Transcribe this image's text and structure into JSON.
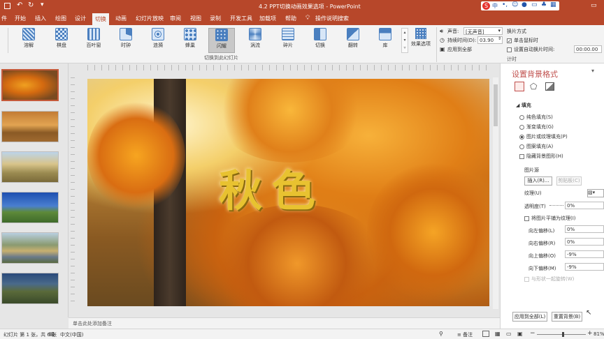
{
  "titlebar": {
    "doc_title": "4.2 PPT切换动画效果选项 - PowerPoint",
    "ime_label": "中",
    "window_btns": [
      "─",
      "□",
      "✕"
    ]
  },
  "tabs": [
    {
      "label": "件"
    },
    {
      "label": "开始"
    },
    {
      "label": "插入"
    },
    {
      "label": "绘图"
    },
    {
      "label": "设计"
    },
    {
      "label": "切换",
      "active": true
    },
    {
      "label": "动画"
    },
    {
      "label": "幻灯片放映"
    },
    {
      "label": "审阅"
    },
    {
      "label": "视图"
    },
    {
      "label": "录制"
    },
    {
      "label": "开发工具"
    },
    {
      "label": "加载项"
    },
    {
      "label": "帮助"
    },
    {
      "label": "操作说明搜索"
    }
  ],
  "ribbon": {
    "effects": [
      {
        "label": "溶解",
        "icon": "dissolve-icon"
      },
      {
        "label": "棋盘",
        "icon": "checkerboard-icon"
      },
      {
        "label": "百叶窗",
        "icon": "blinds-icon"
      },
      {
        "label": "时钟",
        "icon": "clock-icon"
      },
      {
        "label": "涟漪",
        "icon": "ripple-icon"
      },
      {
        "label": "蜂巢",
        "icon": "honeycomb-icon"
      },
      {
        "label": "闪耀",
        "icon": "glitter-icon",
        "selected": true
      },
      {
        "label": "涡流",
        "icon": "vortex-icon"
      },
      {
        "label": "碎片",
        "icon": "shred-icon"
      },
      {
        "label": "切换",
        "icon": "switch-icon"
      },
      {
        "label": "翻转",
        "icon": "flip-icon"
      },
      {
        "label": "库",
        "icon": "gallery-icon"
      }
    ],
    "effect_options_label": "效果选项",
    "group_label": "切换到此幻灯片",
    "sound_label": "声音:",
    "sound_value": "[无声音]",
    "duration_label": "持续时间(D):",
    "duration_value": "03.90",
    "apply_all_label": "应用到全部",
    "advance_label": "换片方式",
    "on_click_label": "单击鼠标时",
    "auto_label": "设置自动换片时间:",
    "auto_value": "00:00.00",
    "timing_label": "计时"
  },
  "slide": {
    "title_text": "秋色"
  },
  "thumbnails": [
    {
      "num": "1",
      "tone": "autumn"
    },
    {
      "num": "2",
      "tone": "desert"
    },
    {
      "num": "3",
      "tone": "hills"
    },
    {
      "num": "4",
      "tone": "blue-sky"
    },
    {
      "num": "5",
      "tone": "river"
    },
    {
      "num": "6",
      "tone": "forest"
    }
  ],
  "format_pane": {
    "title": "设置背景格式",
    "section_fill": "填充",
    "fill_options": [
      {
        "label": "纯色填充(S)",
        "on": false
      },
      {
        "label": "渐变填充(G)",
        "on": false
      },
      {
        "label": "图片或纹理填充(P)",
        "on": true
      },
      {
        "label": "图案填充(A)",
        "on": false
      }
    ],
    "hide_bg_label": "隐藏背景图形(H)",
    "picture_source_label": "图片源",
    "insert_btn": "插入(R)...",
    "clipboard_btn": "剪贴板(C)",
    "texture_label": "纹理(U)",
    "transparency_label": "透明度(T)",
    "transparency_value": "0%",
    "tile_label": "将图片平铺为纹理(I)",
    "offsets": [
      {
        "label": "向左偏移(L)",
        "value": "0%"
      },
      {
        "label": "向右偏移(R)",
        "value": "0%"
      },
      {
        "label": "向上偏移(O)",
        "value": "-9%"
      },
      {
        "label": "向下偏移(M)",
        "value": "-9%"
      }
    ],
    "rotate_label": "与形状一起旋转(W)",
    "apply_all_btn": "应用到全部(L)",
    "reset_btn": "重置背景(B)"
  },
  "notes_placeholder": "单击此处添加备注",
  "status": {
    "slide_info": "幻灯片 第 1 张，共 6 张",
    "language": "中文(中国)",
    "notes_btn": "备注",
    "zoom": "81%"
  },
  "colors": {
    "accent": "#b7472a",
    "ribbon": "#f3f3f3",
    "text_gold": "#e8c230"
  }
}
